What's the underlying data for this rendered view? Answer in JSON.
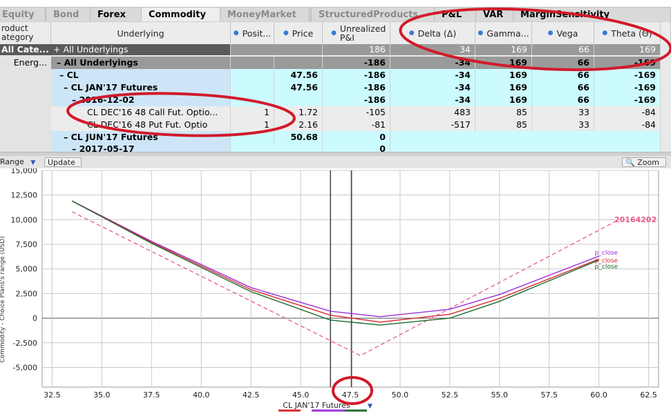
{
  "tabs": [
    {
      "label": "Equity",
      "active": false
    },
    {
      "label": "Bond",
      "active": false
    },
    {
      "label": "Forex",
      "active": false
    },
    {
      "label": "Commodity",
      "active": true
    },
    {
      "label": "MoneyMarket",
      "active": false
    },
    {
      "label": "StructuredProducts",
      "active": false
    },
    {
      "label": "P&L",
      "active": false
    },
    {
      "label": "VAR",
      "active": false
    },
    {
      "label": "MarginSensitivity",
      "active": false
    }
  ],
  "grid": {
    "left_header": "roduct ategory",
    "columns": [
      "Underlying",
      "Posit...",
      "Price",
      "Unrealized P&I",
      "Delta (Δ)",
      "Gamma...",
      "Vega",
      "Theta (Θ)"
    ],
    "left_rows": [
      "All Cate...",
      "Energ..."
    ],
    "rows": [
      {
        "label": "All Underlyings",
        "prefix": "+",
        "pos": "",
        "price": "",
        "upl": "186",
        "delta": "34",
        "gamma": "169",
        "vega": "66",
        "theta": "169"
      },
      {
        "label": "All Underlyings",
        "prefix": "–",
        "pos": "",
        "price": "",
        "upl": "-186",
        "delta": "-34",
        "gamma": "169",
        "vega": "66",
        "theta": "-169"
      },
      {
        "label": "CL",
        "prefix": "–",
        "pos": "",
        "price": "47.56",
        "upl": "-186",
        "delta": "-34",
        "gamma": "169",
        "vega": "66",
        "theta": "-169"
      },
      {
        "label": "CL JAN'17 Futures",
        "prefix": "–",
        "pos": "",
        "price": "47.56",
        "upl": "-186",
        "delta": "-34",
        "gamma": "169",
        "vega": "66",
        "theta": "-169"
      },
      {
        "label": "2016-12-02",
        "prefix": "–",
        "pos": "",
        "price": "",
        "upl": "-186",
        "delta": "-34",
        "gamma": "169",
        "vega": "66",
        "theta": "-169"
      },
      {
        "label": "CL DEC'16 48 Call Fut. Optio...",
        "prefix": "",
        "pos": "1",
        "price": "1.72",
        "upl": "-105",
        "delta": "483",
        "gamma": "85",
        "vega": "33",
        "theta": "-84"
      },
      {
        "label": "CL DEC'16 48 Put Fut. Optio",
        "prefix": "",
        "pos": "1",
        "price": "2.16",
        "upl": "-81",
        "delta": "-517",
        "gamma": "85",
        "vega": "33",
        "theta": "-84"
      },
      {
        "label": "CL JUN'17 Futures",
        "prefix": "–",
        "pos": "",
        "price": "50.68",
        "upl": "0",
        "delta": "",
        "gamma": "",
        "vega": "",
        "theta": ""
      },
      {
        "label": "2017-05-17",
        "prefix": "–",
        "pos": "",
        "price": "",
        "upl": "0",
        "delta": "",
        "gamma": "",
        "vega": "",
        "theta": ""
      }
    ]
  },
  "toolbar": {
    "range_label": "Range",
    "update_label": "Update",
    "zoom_label": "Zoom"
  },
  "chart_data": {
    "type": "line",
    "xlabel": "CL JAN'17 Futures",
    "ylabel": "Commodity - Choice Plans's range (USD)",
    "xlim": [
      32.0,
      63.0
    ],
    "ylim": [
      -7000,
      15000
    ],
    "xticks": [
      32.5,
      35.0,
      37.5,
      40.0,
      42.5,
      45.0,
      47.5,
      50.0,
      52.5,
      55.0,
      57.5,
      60.0,
      62.5
    ],
    "xtick_labels": [
      "32.5",
      "35.0",
      "37.5",
      "40.0",
      "42.5",
      "45.0",
      "47.5",
      "50.0",
      "52.5",
      "55.0",
      "57.5",
      "60.0",
      "62.5"
    ],
    "yticks": [
      15000,
      12500,
      10000,
      7500,
      5000,
      2500,
      0,
      -2500,
      -5000
    ],
    "ytick_labels": [
      "15,000",
      "12,500",
      "10,000",
      "7,500",
      "5,000",
      "2,500",
      "0",
      "-2,500",
      "-5,000"
    ],
    "vlines": [
      46.5,
      47.56
    ],
    "series": [
      {
        "name": "20164202",
        "color": "#e8598f",
        "dashed": true,
        "x": [
          33.5,
          48.0,
          61.0
        ],
        "y": [
          10800,
          -3800,
          10000
        ]
      },
      {
        "name": "p_close",
        "color": "#9b30d9",
        "dashed": false,
        "x": [
          33.5,
          37.5,
          42.5,
          46.5,
          49.0,
          52.5,
          55.0,
          60.0
        ],
        "y": [
          11900,
          7800,
          3100,
          700,
          150,
          900,
          2400,
          6300
        ]
      },
      {
        "name": "p_close",
        "color": "#d8272e",
        "dashed": false,
        "x": [
          33.5,
          37.5,
          42.5,
          46.5,
          49.0,
          52.5,
          55.0,
          60.0
        ],
        "y": [
          11900,
          7700,
          2900,
          300,
          -400,
          400,
          2000,
          6000
        ]
      },
      {
        "name": "p_close",
        "color": "#1e6b2c",
        "dashed": false,
        "x": [
          33.5,
          37.5,
          42.5,
          46.5,
          49.0,
          52.5,
          55.0,
          60.0
        ],
        "y": [
          11900,
          7600,
          2700,
          -200,
          -700,
          0,
          1700,
          5900
        ]
      }
    ],
    "legend_colors": [
      "#d8272e",
      "#9b30d9",
      "#1e6b2c"
    ]
  },
  "colors": {
    "band": "#cde6f7",
    "cyan": "#ccfbff",
    "dark": "#5a5a5a",
    "mid": "#9a9a9a",
    "annotation": "#d21a2a"
  }
}
